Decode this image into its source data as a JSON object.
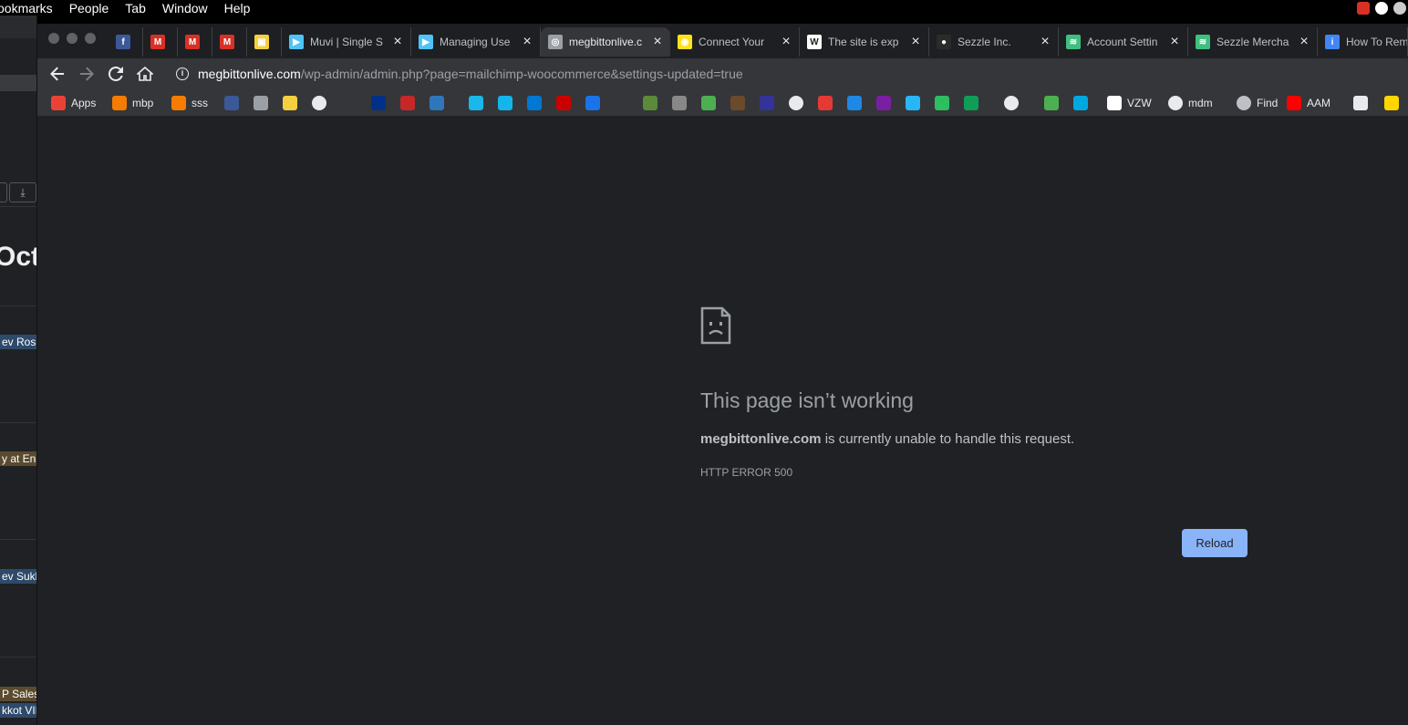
{
  "menubar": {
    "items": [
      "ookmarks",
      "People",
      "Tab",
      "Window",
      "Help"
    ]
  },
  "background_window": {
    "heading_fragment": "Octo",
    "events": [
      "ev Rosh",
      "y at En",
      "ev Sukko",
      "P Sales",
      "kkot VII"
    ]
  },
  "tabs": [
    {
      "title": "",
      "icon": "facebook-icon",
      "color": "#3b5998",
      "glyph": "f"
    },
    {
      "title": "",
      "icon": "gmail-icon",
      "color": "#d93025",
      "glyph": "M"
    },
    {
      "title": "",
      "icon": "gmail-icon",
      "color": "#d93025",
      "glyph": "M"
    },
    {
      "title": "",
      "icon": "gmail-icon",
      "color": "#d93025",
      "glyph": "M"
    },
    {
      "title": "",
      "icon": "ticket-icon",
      "color": "#f4d03f",
      "glyph": "▣"
    },
    {
      "title": "Muvi | Single S",
      "icon": "muvi-icon",
      "color": "#4fc3f7",
      "glyph": "▶",
      "closable": true
    },
    {
      "title": "Managing Use",
      "icon": "muvi-icon",
      "color": "#4fc3f7",
      "glyph": "▶",
      "closable": true
    },
    {
      "title": "megbittonlive.c",
      "icon": "globe-icon",
      "color": "#9aa0a6",
      "glyph": "◎",
      "closable": true,
      "active": true
    },
    {
      "title": "Connect Your",
      "icon": "mailchimp-icon",
      "color": "#ffe01b",
      "glyph": "◉",
      "closable": true
    },
    {
      "title": "The site is exp",
      "icon": "wordpress-icon",
      "color": "#ffffff",
      "glyph": "W",
      "closable": true
    },
    {
      "title": "Sezzle Inc.",
      "icon": "github-icon",
      "color": "#2b2b2b",
      "glyph": "●",
      "closable": true
    },
    {
      "title": "Account Settin",
      "icon": "sezzle-icon",
      "color": "#3fbf7f",
      "glyph": "≋",
      "closable": true
    },
    {
      "title": "Sezzle Mercha",
      "icon": "sezzle-icon",
      "color": "#3fbf7f",
      "glyph": "≋",
      "closable": true
    },
    {
      "title": "How To Rem",
      "icon": "info-icon",
      "color": "#4285f4",
      "glyph": "i",
      "closable": false
    }
  ],
  "omnibox": {
    "host": "megbittonlive.com",
    "path": "/wp-admin/admin.php?page=mailchimp-woocommerce&settings-updated=true"
  },
  "bookmarks": [
    {
      "label": "Apps",
      "icon": "apps-grid-icon",
      "color": "#ea4335"
    },
    {
      "label": "mbp",
      "icon": "cube-icon",
      "color": "#f57c00"
    },
    {
      "label": "sss",
      "icon": "cube-icon",
      "color": "#f57c00"
    },
    {
      "label": "",
      "icon": "facebook-icon",
      "color": "#3b5998"
    },
    {
      "label": "",
      "icon": "image-icon",
      "color": "#9aa0a6"
    },
    {
      "label": "",
      "icon": "ticket-icon",
      "color": "#f4d03f"
    },
    {
      "label": "",
      "icon": "globe-icon",
      "color": "#e8eaed"
    },
    {
      "label": "",
      "icon": "paypal-icon",
      "color": "#003087"
    },
    {
      "label": "",
      "icon": "arrow-icon",
      "color": "#c62828"
    },
    {
      "label": "",
      "icon": "amex-icon",
      "color": "#2e77bb"
    },
    {
      "label": "",
      "icon": "vimeo-icon",
      "color": "#1ab7ea"
    },
    {
      "label": "",
      "icon": "xero-icon",
      "color": "#13b5ea"
    },
    {
      "label": "",
      "icon": "outlook-icon",
      "color": "#0078d4"
    },
    {
      "label": "",
      "icon": "cnn-icon",
      "color": "#cc0000"
    },
    {
      "label": "",
      "icon": "drop-icon",
      "color": "#1a73e8"
    },
    {
      "label": "",
      "icon": "cube-green-icon",
      "color": "#5a8a3a"
    },
    {
      "label": "",
      "icon": "mb-icon",
      "color": "#888888"
    },
    {
      "label": "",
      "icon": "leaf-icon",
      "color": "#4caf50"
    },
    {
      "label": "",
      "icon": "ups-icon",
      "color": "#6b4a2b"
    },
    {
      "label": "",
      "icon": "usps-icon",
      "color": "#333399"
    },
    {
      "label": "",
      "icon": "globe-icon",
      "color": "#e8eaed"
    },
    {
      "label": "",
      "icon": "e-icon",
      "color": "#e53935"
    },
    {
      "label": "",
      "icon": "blob-icon",
      "color": "#1e88e5"
    },
    {
      "label": "",
      "icon": "plane-icon",
      "color": "#7b1fa2"
    },
    {
      "label": "",
      "icon": "square-icon",
      "color": "#29b6f6"
    },
    {
      "label": "",
      "icon": "evernote-icon",
      "color": "#2dbe60"
    },
    {
      "label": "",
      "icon": "sheet-icon",
      "color": "#0f9d58"
    },
    {
      "label": "",
      "icon": "globe-icon",
      "color": "#e8eaed"
    },
    {
      "label": "",
      "icon": "spinner-icon",
      "color": "#4caf50"
    },
    {
      "label": "",
      "icon": "att-icon",
      "color": "#00a8e0"
    },
    {
      "label": "VZW",
      "icon": "vzw-icon",
      "color": "#ffffff"
    },
    {
      "label": "mdm",
      "icon": "globe-icon",
      "color": "#e8eaed"
    },
    {
      "label": "Find",
      "icon": "apple-icon",
      "color": "#bdc1c6"
    },
    {
      "label": "AAM",
      "icon": "adobe-icon",
      "color": "#ff0000"
    },
    {
      "label": "",
      "icon": "stripe-icon",
      "color": "#e8eaed"
    },
    {
      "label": "",
      "icon": "m-icon",
      "color": "#ffd600"
    }
  ],
  "error": {
    "title": "This page isn’t working",
    "host": "megbittonlive.com",
    "message": " is currently unable to handle this request.",
    "code": "HTTP ERROR 500",
    "reload_label": "Reload"
  }
}
